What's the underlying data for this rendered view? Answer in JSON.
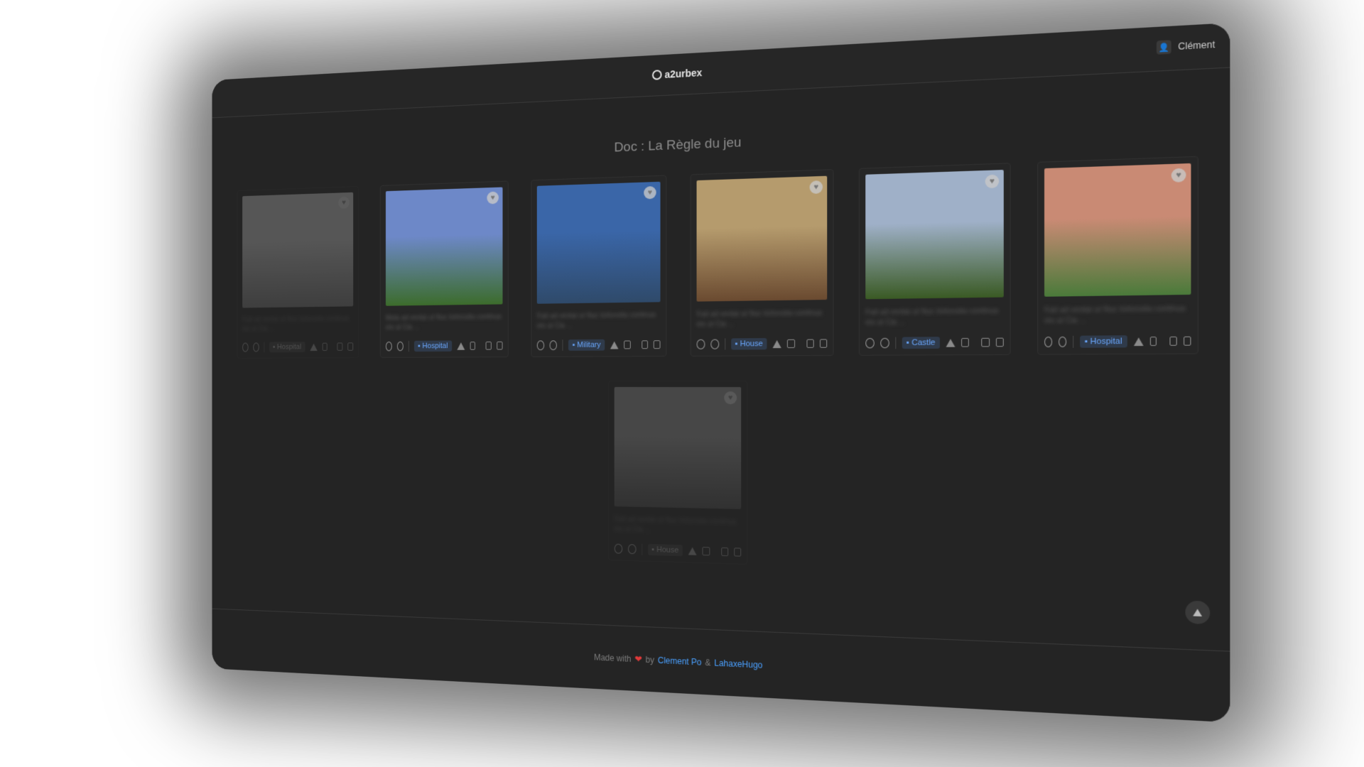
{
  "app": {
    "logo_text": "a2urbex"
  },
  "user": {
    "name": "Clément"
  },
  "page": {
    "title": "Doc : La Règle du jeu"
  },
  "cards": [
    {
      "category": "Hospital",
      "faded": true,
      "desc": "Fait ad ventai ut Nuc lorlonsita continua eis ut Cia ...",
      "image_colors": [
        "#b5b5b5",
        "#6f6f6f"
      ]
    },
    {
      "category": "Hospital",
      "faded": false,
      "desc": "Mola ad ventai ut Nuc lorlonsita continua eis ut Cia ...",
      "image_colors": [
        "#6d88c8",
        "#3c6c2c"
      ]
    },
    {
      "category": "Military",
      "faded": false,
      "desc": "Fait ad ventai ut Nuc lorlonsita continua eis ut Cia ...",
      "image_colors": [
        "#3a66a8",
        "#2f4a6a"
      ]
    },
    {
      "category": "House",
      "faded": false,
      "desc": "Fait ad ventai ut Nuc lorlonsita continua eis ut Cia ...",
      "image_colors": [
        "#b59b6d",
        "#6a4a30"
      ]
    },
    {
      "category": "Castle",
      "faded": false,
      "desc": "Fait ad ventai ut Nuc lorlonsita continua eis ut Cia ...",
      "image_colors": [
        "#9fb0c8",
        "#3a5a24"
      ]
    },
    {
      "category": "Hospital",
      "faded": false,
      "desc": "Fait ad ventai ut Nuc lorlonsita continua eis ut Cia ...",
      "image_colors": [
        "#c98a74",
        "#4a7a3a"
      ]
    }
  ],
  "second_row": [
    {
      "category": "House",
      "faded": true,
      "desc": "Fait ad ventai ut Nuc lorlonsita continua eis ut Cia ...",
      "image_colors": [
        "#8a8a8a",
        "#4a4a4a"
      ]
    }
  ],
  "footer": {
    "made_with": "Made with",
    "by": "by",
    "author1": "Clement Po",
    "amp": "&",
    "author2": "LahaxeHugo"
  },
  "icons": {
    "map_button": "map-icon",
    "favorite": "heart-icon"
  }
}
